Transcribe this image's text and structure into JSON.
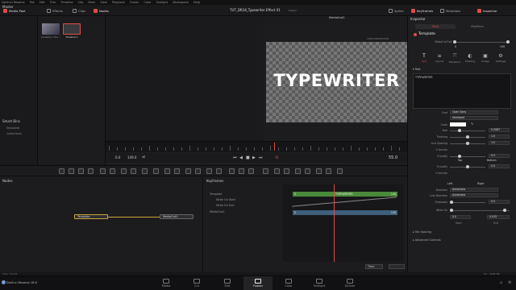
{
  "menubar": {
    "items": [
      "DaVinci Resolve",
      "File",
      "Edit",
      "Trim",
      "Timeline",
      "Clip",
      "Mark",
      "View",
      "Playback",
      "Fusion",
      "Color",
      "Fairlight",
      "Workspace",
      "Help"
    ]
  },
  "toolbar": {
    "left": [
      "Media Pool",
      "Effects",
      "Clips",
      "Nodes"
    ],
    "project_title": "TUT_DR18_Typewriter Effect 01",
    "project_status": "Edited",
    "right": [
      "Spline",
      "Keyframes",
      "Metadata",
      "Inspector"
    ]
  },
  "media": {
    "master_label": "Master",
    "smart_bins_label": "Smart Bins",
    "smart_bins": [
      "Keywords",
      "Collections"
    ],
    "clips": [
      {
        "label": "possibly 1 dis..."
      },
      {
        "label": "Timeline 1"
      }
    ]
  },
  "viewer": {
    "output_label": "MediaOut1",
    "resolution": "1920x1080xfloat32",
    "canvas_text": "TYPEWRITER",
    "tc_in": "0.0",
    "tc_out": "149.0",
    "tc_current": "55.0"
  },
  "nodes": {
    "panel_label": "Nodes",
    "items": [
      {
        "label": "Template"
      },
      {
        "label": "MediaOut1"
      }
    ]
  },
  "keyframes": {
    "panel_label": "Keyframes",
    "rows": [
      "Template",
      "Write On Start",
      "Write On End",
      "MediaOut1"
    ],
    "bars": [
      {
        "label": "TYPEWRITER",
        "start": "0",
        "end": "149",
        "color": "#4a8a3a"
      },
      {
        "label": "",
        "start": "0",
        "end": "149",
        "color": "#3f5f7a"
      }
    ],
    "time_select": "Time"
  },
  "inspector": {
    "title": "Inspector",
    "tabs": [
      "Tools",
      "Modifiers"
    ],
    "tool_name": "Template",
    "global_inout_label": "Global In/Out",
    "global_in": "0",
    "global_out": "149",
    "sub_tabs": [
      {
        "glyph": "T",
        "label": "Text"
      },
      {
        "glyph": "≡",
        "label": "Layout"
      },
      {
        "glyph": "⤧",
        "label": "Transform"
      },
      {
        "glyph": "◐",
        "label": "Shading"
      },
      {
        "glyph": "▣",
        "label": "Image"
      },
      {
        "glyph": "⚙",
        "label": "Settings"
      }
    ],
    "text_section": "Text",
    "styled_text": "TYPEWRITER",
    "font_label": "Font",
    "font_value": "Open Sans",
    "font_style": "Semibold",
    "color_label": "Color",
    "size_label": "Size",
    "size_value": "0.2087",
    "tracking_label": "Tracking",
    "tracking_value": "1.0",
    "line_spacing_label": "Line Spacing",
    "line_spacing_value": "1.0",
    "v_anchor_label": "V Anchor",
    "v_anchor_opts": [
      "Top",
      "Bottom"
    ],
    "v_justify_label": "V Justify",
    "v_justify_value": "0.0",
    "h_anchor_label": "H Anchor",
    "h_anchor_opts": [
      "Left",
      "Right"
    ],
    "h_justify_label": "H Justify",
    "h_justify_value": "0.0",
    "direction_label": "Direction",
    "direction_value": "Automatic",
    "line_direction_label": "Line Direction",
    "line_direction_value": "Automatic",
    "emphasis_label": "Emphasis",
    "emphasis_value": "0.0",
    "write_on_label": "Write On",
    "write_on_start": "0.0",
    "write_on_end": "0.915",
    "start_label": "Start",
    "end_label": "End",
    "tab_spacing": "Tab Spacing",
    "advanced_controls": "Advanced Controls"
  },
  "status": {
    "left": "Time: 119.45",
    "right": "5% - 3608 MB"
  },
  "pages": [
    "Media",
    "Cut",
    "Edit",
    "Fusion",
    "Color",
    "Fairlight",
    "Deliver"
  ],
  "active_page": "Fusion",
  "brand": "DaVinci Resolve 18.6",
  "colors": {
    "accent": "#e04a4a",
    "node_link": "#c9a43a"
  }
}
